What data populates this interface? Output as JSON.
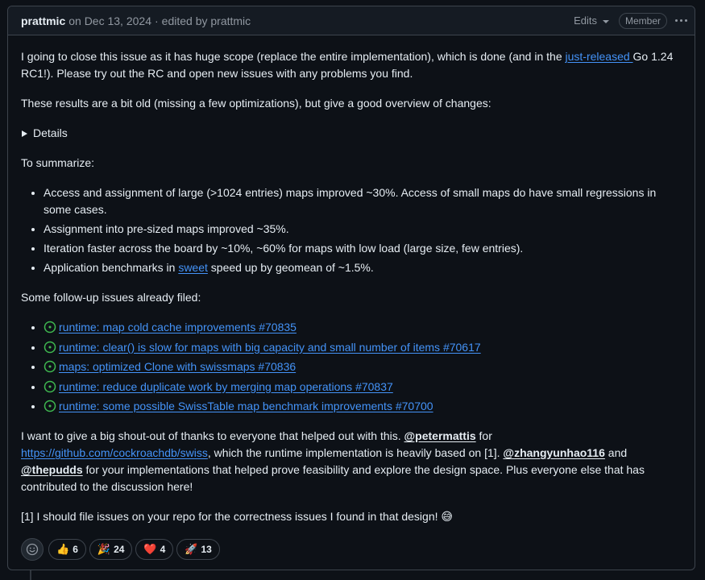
{
  "header": {
    "author": "prattmic",
    "date": "on Dec 13, 2024",
    "sep": "·",
    "edited": "edited by prattmic",
    "edits_label": "Edits",
    "role_badge": "Member"
  },
  "body": {
    "p1_a": "I going to close this issue as it has huge scope (replace the entire implementation), which is done (and in the ",
    "p1_link": "just-released ",
    "p1_b": "Go 1.24 RC1!). Please try out the RC and open new issues with any problems you find.",
    "p2": "These results are a bit old (missing a few optimizations), but give a good overview of changes:",
    "details_label": "Details",
    "summary_intro": "To summarize:",
    "bullets": [
      "Access and assignment of large (>1024 entries) maps improved ~30%. Access of small maps do have small regressions in some cases.",
      "Assignment into pre-sized maps improved ~35%.",
      "Iteration faster across the board by ~10%, ~60% for maps with low load (large size, few entries)."
    ],
    "bullet4_a": "Application benchmarks in ",
    "bullet4_link": "sweet",
    "bullet4_b": " speed up by geomean of ~1.5%.",
    "followup_intro": "Some follow-up issues already filed:",
    "issues": [
      "runtime: map cold cache improvements #70835",
      "runtime: clear() is slow for maps with big capacity and small number of items #70617",
      "maps: optimized Clone with swissmaps #70836",
      "runtime: reduce duplicate work by merging map operations #70837",
      "runtime: some possible SwissTable map benchmark improvements #70700"
    ],
    "thanks_a": "I want to give a big shout-out of thanks to everyone that helped out with this. ",
    "mention1": "@petermattis",
    "thanks_b": " for ",
    "swiss_link": "https://github.com/cockroachdb/swiss",
    "thanks_c": ", which the runtime implementation is heavily based on [1]. ",
    "mention2": "@zhangyunhao116",
    "thanks_d": " and ",
    "mention3": "@thepudds",
    "thanks_e": " for your implementations that helped prove feasibility and explore the design space. Plus everyone else that has contributed to the discussion here!",
    "footnote": "[1] I should file issues on your repo for the correctness issues I found in that design! 😅"
  },
  "reactions": [
    {
      "emoji": "👍",
      "count": "6",
      "icon": "thumbs-up"
    },
    {
      "emoji": "🎉",
      "count": "24",
      "icon": "hooray"
    },
    {
      "emoji": "❤️",
      "count": "4",
      "icon": "heart"
    },
    {
      "emoji": "🚀",
      "count": "13",
      "icon": "rocket"
    }
  ],
  "colors": {
    "background": "#0d1117",
    "link": "#4493f8",
    "open_issue": "#3fb950",
    "border": "#3d444d"
  }
}
